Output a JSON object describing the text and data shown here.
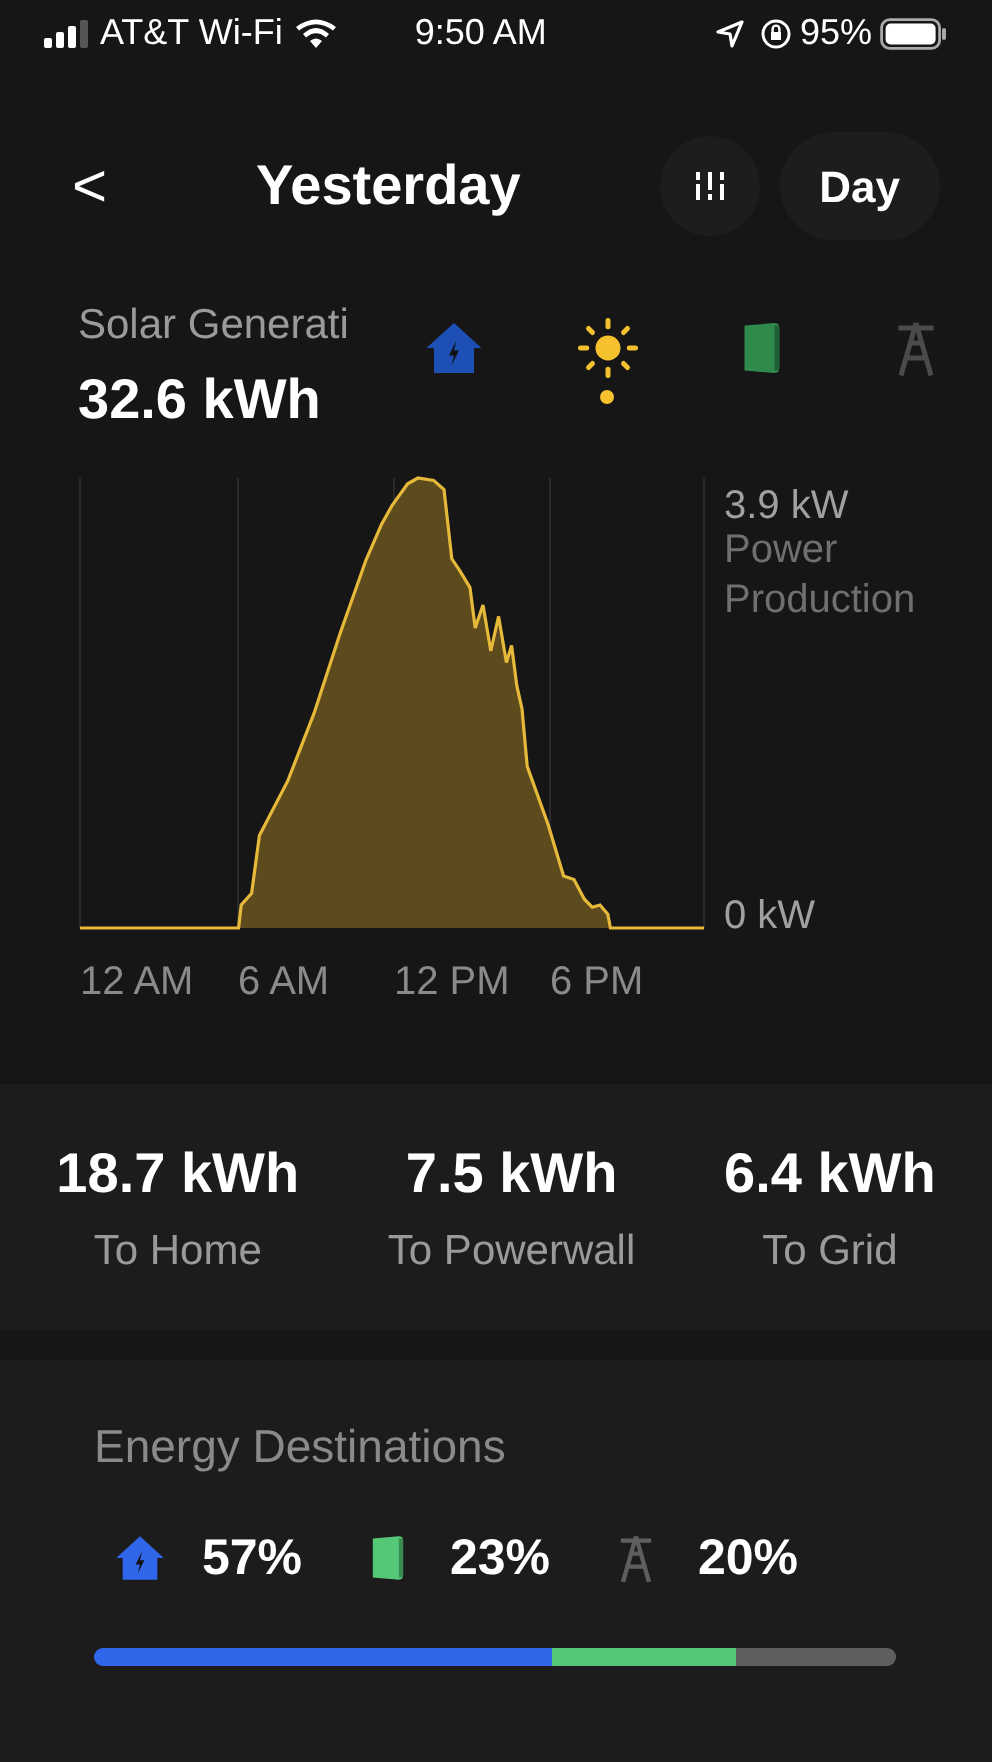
{
  "status_bar": {
    "carrier": "AT&T Wi-Fi",
    "time": "9:50 AM",
    "battery": "95%"
  },
  "header": {
    "back": "<",
    "title": "Yesterday",
    "period": "Day"
  },
  "summary": {
    "label": "Solar Generati",
    "value": "32.6 kWh"
  },
  "sources": [
    {
      "kind": "home",
      "color": "#1e4fb4",
      "selected": false
    },
    {
      "kind": "solar",
      "color": "#f5c12e",
      "selected": true
    },
    {
      "kind": "powerwall",
      "color": "#2f8a4c",
      "selected": false
    },
    {
      "kind": "grid",
      "color": "#4a4a4a",
      "selected": false
    }
  ],
  "chart": {
    "y_max": "3.9 kW",
    "y_title": "Power Production",
    "y_min": "0 kW",
    "x_labels": [
      "12 AM",
      "6 AM",
      "12 PM",
      "6 PM"
    ]
  },
  "totals": [
    {
      "value": "18.7 kWh",
      "label": "To Home"
    },
    {
      "value": "7.5 kWh",
      "label": "To Powerwall"
    },
    {
      "value": "6.4 kWh",
      "label": "To Grid"
    }
  ],
  "destinations": {
    "title": "Energy Destinations",
    "items": [
      {
        "kind": "home",
        "percent": "57%",
        "color": "#2f66ea"
      },
      {
        "kind": "powerwall",
        "percent": "23%",
        "color": "#55c878"
      },
      {
        "kind": "grid",
        "percent": "20%",
        "color": "#5e5e5e"
      }
    ]
  }
}
